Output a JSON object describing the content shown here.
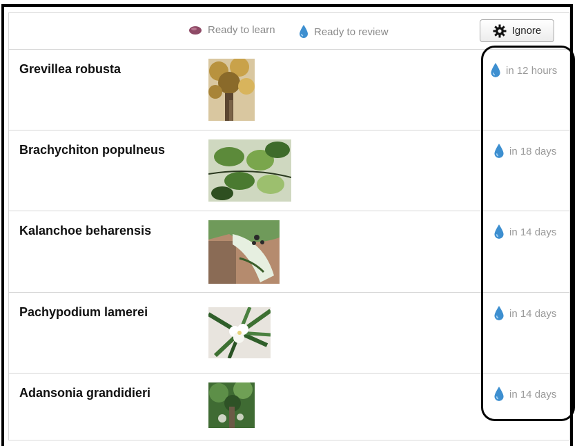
{
  "legend": {
    "learn_label": "Ready to learn",
    "review_label": "Ready to review",
    "learn_color": "#8e4a66",
    "review_color": "#3d8fd0"
  },
  "toolbar": {
    "ignore_label": "Ignore"
  },
  "rows": [
    {
      "name": "Grevillea robusta",
      "due": "in 12 hours",
      "photo": "tree-trunk-photo"
    },
    {
      "name": "Brachychiton populneus",
      "due": "in 18 days",
      "photo": "green-leaves-photo"
    },
    {
      "name": "Kalanchoe beharensis",
      "due": "in 14 days",
      "photo": "leaf-closeup-photo"
    },
    {
      "name": "Pachypodium lamerei",
      "due": "in 14 days",
      "photo": "white-flower-photo"
    },
    {
      "name": "Adansonia grandidieri",
      "due": "in 14 days",
      "photo": "baobab-photo"
    }
  ]
}
